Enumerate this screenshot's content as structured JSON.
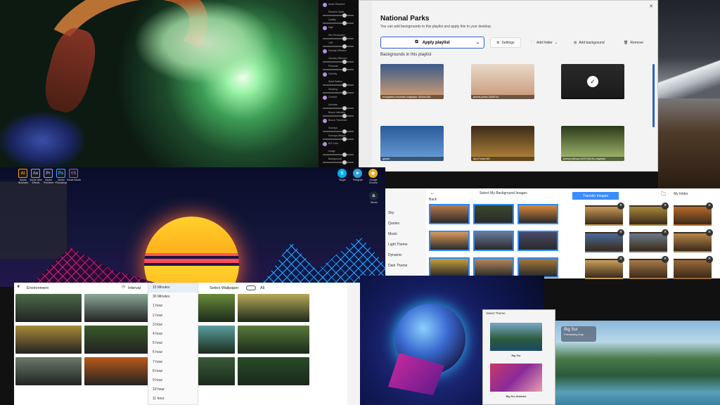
{
  "fluid_settings": {
    "items": [
      "Audio Reactive",
      "Random Splat",
      "Quality",
      "High",
      "Sim Resolution",
      "128",
      "Density Diffusion",
      "Velocity Diffusion",
      "Pressure",
      "Vorticity",
      "Splat Radius",
      "Shading",
      "Colorful",
      "Animate",
      "Bloom Intensity",
      "Bloom Threshold",
      "Sunrays",
      "Sunrays Weight",
      "BG Color",
      "Image",
      "Background"
    ]
  },
  "national_parks": {
    "title": "National Parks",
    "subtitle": "You can add backgrounds to this playlist and apply this to your desktop.",
    "apply_button": "Apply playlist",
    "settings": "Settings",
    "add_folder": "Add folder",
    "add_background": "Add background",
    "remove": "Remove",
    "section": "Backgrounds in this playlist",
    "thumbs": [
      {
        "caption": "ecosystem-mountain-wallpaper 3840x2160",
        "color1": "#3a5a8a",
        "color2": "#d8a070"
      },
      {
        "caption": "pexels-photo-3408744",
        "color1": "#e8d8c8",
        "color2": "#c89878"
      },
      {
        "caption": "",
        "color1": "#2a2a2a",
        "color2": "#1a1a1a"
      },
      {
        "caption": "glacier",
        "color1": "#2a5a9a",
        "color2": "#6aa0d8"
      },
      {
        "caption": "8jon7mbwLMD",
        "color1": "#3a2a1a",
        "color2": "#b8883a"
      },
      {
        "caption": "jeremy-bishop-mOGTy9Uhs-unsplash",
        "color1": "#2a3a1a",
        "color2": "#a8c070"
      }
    ]
  },
  "retro_desktop": {
    "icons": [
      {
        "label": "Adobe Illustrator",
        "glyph": "Ai",
        "color": "#ff9a00"
      },
      {
        "label": "Adobe After Effects",
        "glyph": "Ae",
        "color": "#9999ff"
      },
      {
        "label": "Adobe Premiere",
        "glyph": "Pr",
        "color": "#9999ff"
      },
      {
        "label": "Adobe Photoshop",
        "glyph": "Ps",
        "color": "#31a8ff"
      },
      {
        "label": "Visual Studio",
        "glyph": "VS",
        "color": "#865fc5"
      }
    ],
    "right_icons": [
      {
        "label": "Skype",
        "glyph": "S",
        "color": "#00aff0"
      },
      {
        "label": "Telegram",
        "glyph": "➤",
        "color": "#2aa1da"
      },
      {
        "label": "Google Chrome",
        "glyph": "◉",
        "color": "#e8b020"
      },
      {
        "label": "Steam",
        "glyph": "♨",
        "color": "#1b2838"
      }
    ]
  },
  "environment": {
    "category": "Environment",
    "interval_label": "Interval",
    "select_label": "Select Wallpaper",
    "all": "All",
    "intervals": [
      "15 Minutes",
      "30 Minutes",
      "1 hour",
      "2 hour",
      "3 hour",
      "4 hour",
      "5 hour",
      "6 hour",
      "7 hour",
      "8 hour",
      "9 hour",
      "10 hour",
      "11 hour"
    ],
    "left_photos": [
      "#4a6a4a",
      "#8aa898",
      "#a88a3a",
      "#3a5a2a",
      "#6a7a6a",
      "#b85a1a"
    ],
    "right_photos": [
      "#6a8a3a",
      "#b8a858",
      "#5aa0a0",
      "#5a7a3a",
      "#3a5a3a",
      "#2a4a2a"
    ]
  },
  "bg_images": {
    "title": "Select My Background Images",
    "back": "Back",
    "transfer": "Transfer Images",
    "my_folder": "My  folder",
    "categories": [
      "Sky",
      "Quotes",
      "Music",
      "Light Theme",
      "Dynamic",
      "Dark Theme"
    ],
    "grid": [
      "#b87a4a",
      "#3a4a2a",
      "#d8883a",
      "#d89a5a",
      "#6a7a9a",
      "#4a4a6a",
      "#c8a03a",
      "#b88a5a",
      "#a87a3a"
    ],
    "folder": [
      "#c89a5a",
      "#a8883a",
      "#b86a2a",
      "#4a6a9a",
      "#6a7a8a",
      "#b8884a",
      "#c8a05a",
      "#a87a4a",
      "#9a6a3a"
    ]
  },
  "theme": {
    "title": "Select Theme",
    "items": [
      "Big Sur",
      "Big Sur Abstract"
    ]
  },
  "bigsur": {
    "name": "Big Sur",
    "sub": "Previewing Day"
  }
}
